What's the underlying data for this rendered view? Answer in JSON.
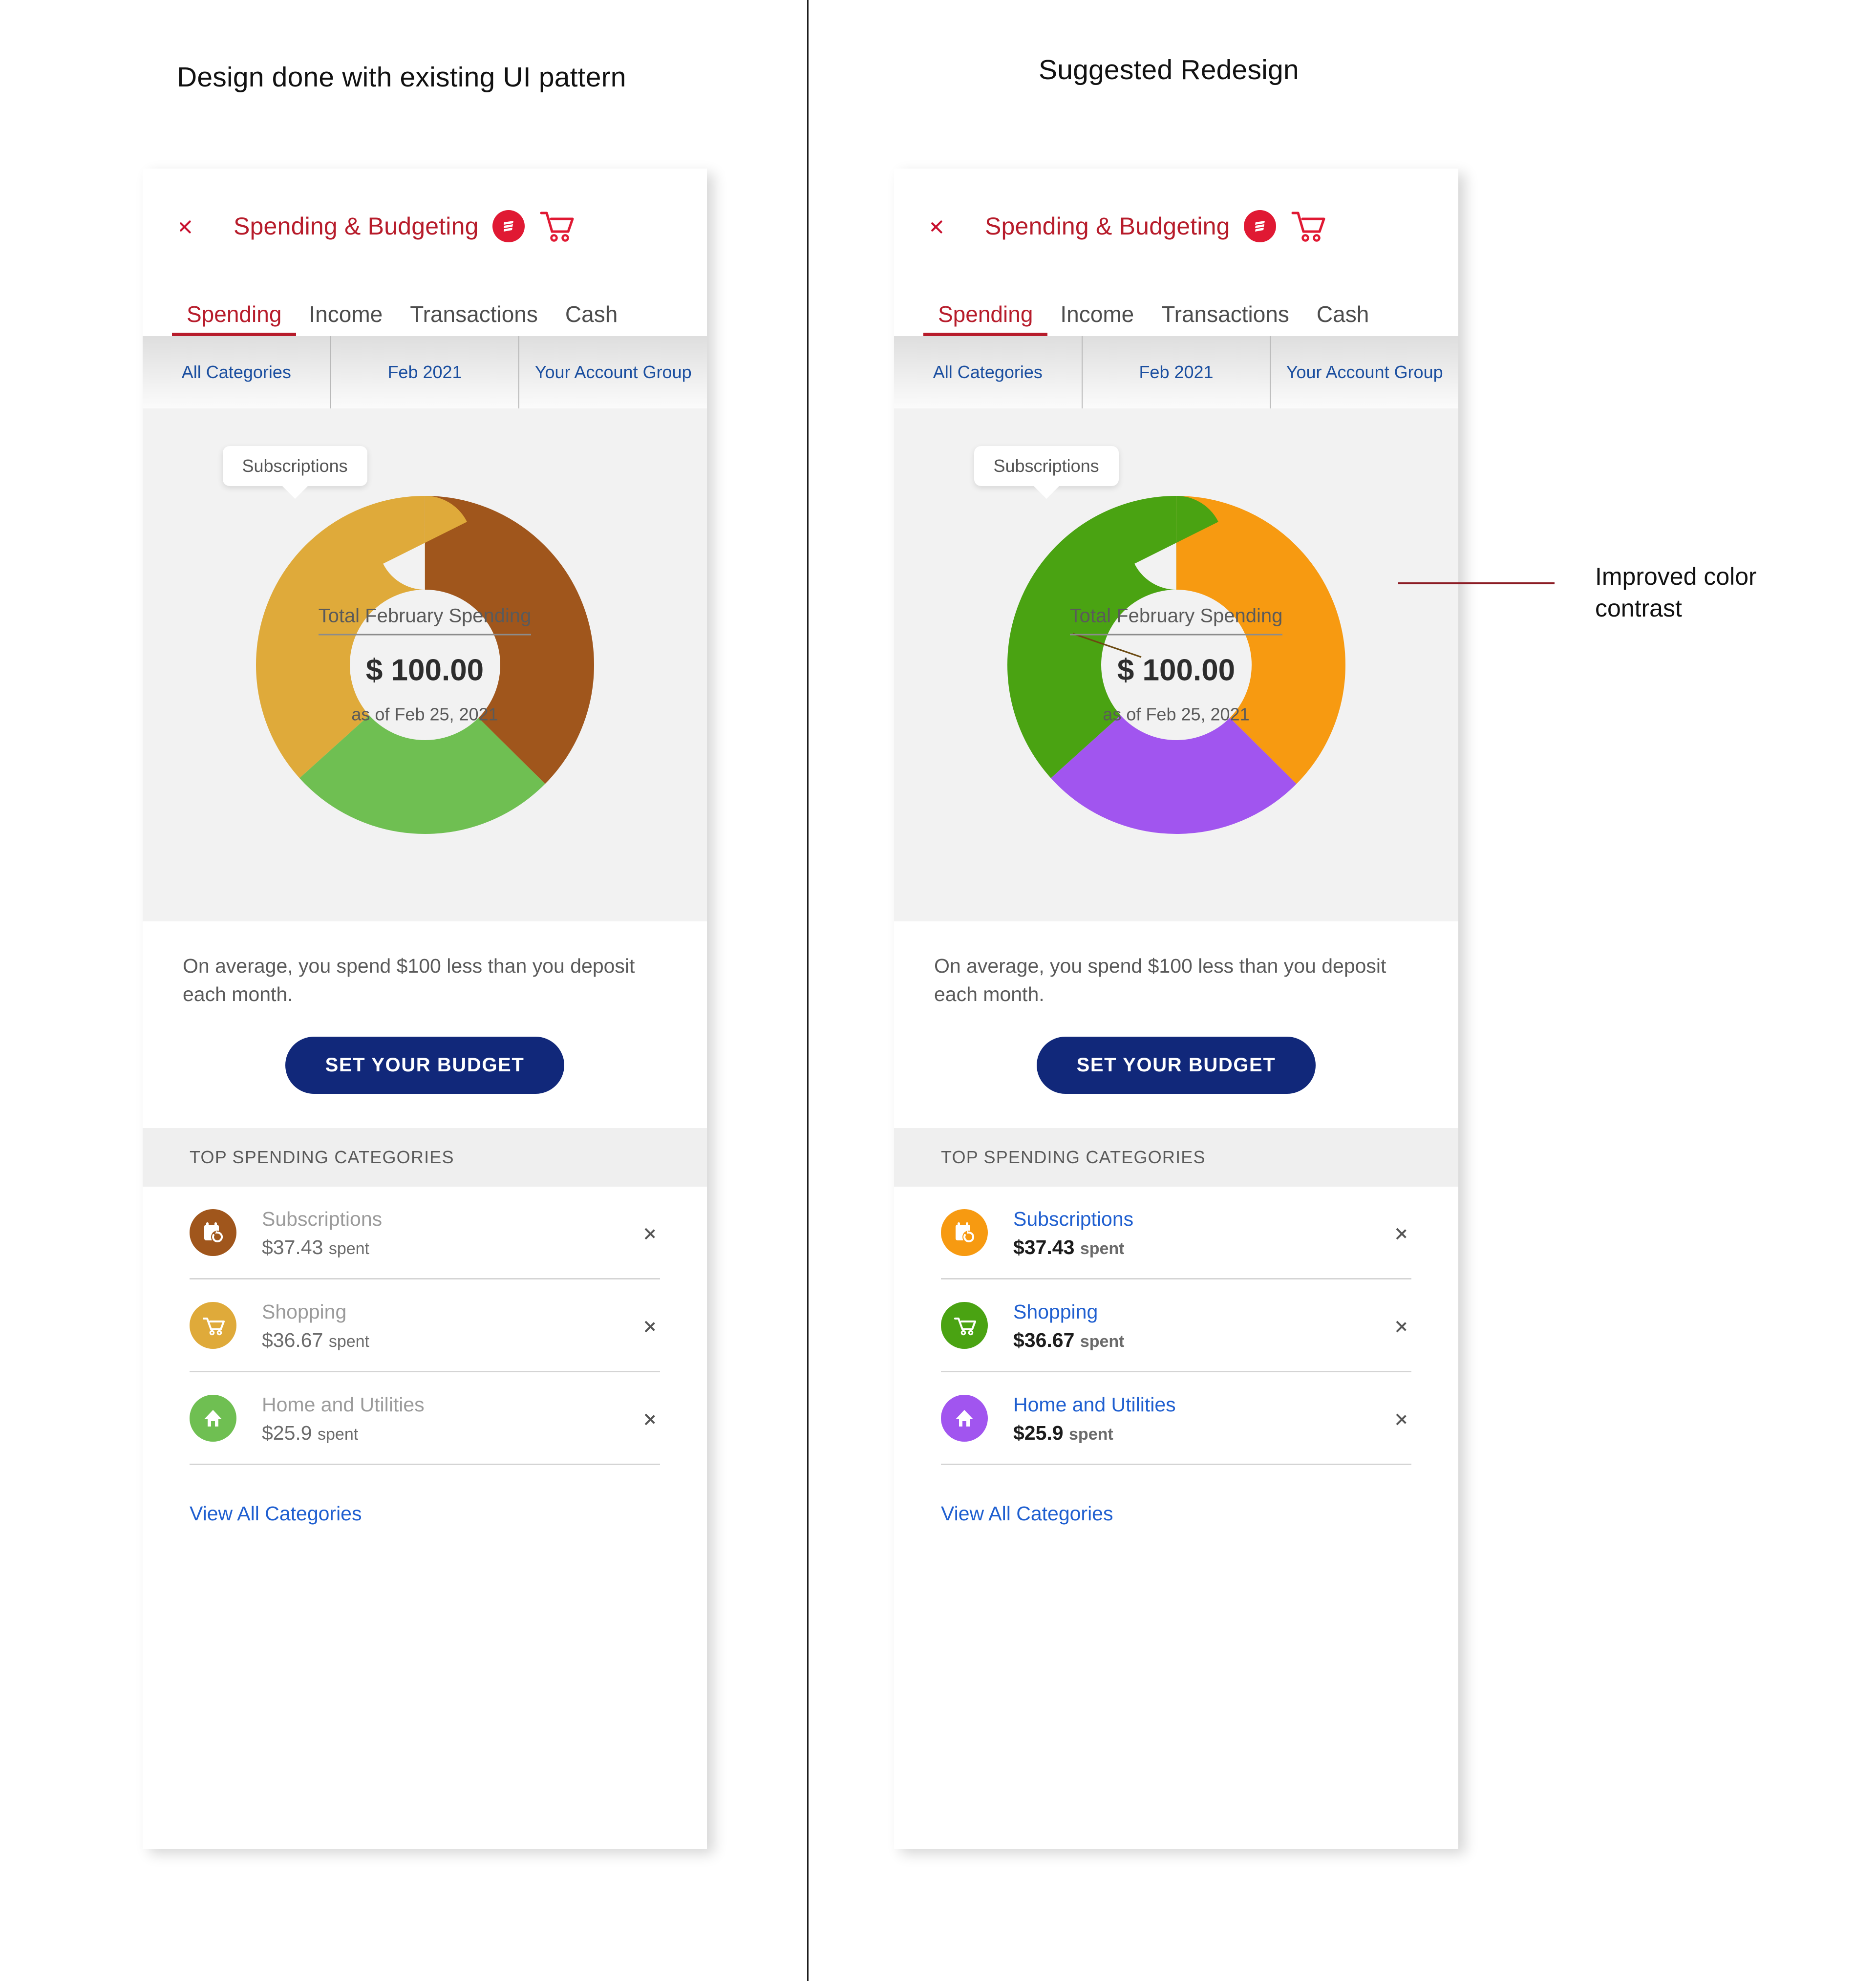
{
  "panels": {
    "left_caption": "Design done with existing UI pattern",
    "right_caption": "Suggested Redesign"
  },
  "annotation": {
    "text": "Improved color contrast",
    "line_color": "#8c1c24"
  },
  "appbar": {
    "back_label": "Back",
    "title": "Spending & Budgeting",
    "brand_icon": "brand-badge-icon",
    "cart_icon": "shopping-cart-icon"
  },
  "tabs": [
    {
      "label": "Spending",
      "active": true
    },
    {
      "label": "Income",
      "active": false
    },
    {
      "label": "Transactions",
      "active": false
    },
    {
      "label": "Cash",
      "active": false
    }
  ],
  "filters": [
    {
      "label": "All Categories"
    },
    {
      "label": "Feb 2021"
    },
    {
      "label": "Your Account Group"
    }
  ],
  "chart_center": {
    "label": "Total February Spending",
    "amount": "$ 100.00",
    "as_of": "as of  Feb 25, 2021"
  },
  "tooltip": {
    "label": "Subscriptions"
  },
  "summary": {
    "text": "On average, you spend $100 less than you deposit each month.",
    "cta_label": "SET YOUR BUDGET",
    "cta_color": "#11287a"
  },
  "categories_section": {
    "header": "TOP SPENDING CATEGORIES",
    "view_all": "View All Categories"
  },
  "categories_old": [
    {
      "name": "Subscriptions",
      "amount": "$37.43",
      "suffix": "spent",
      "icon": "subscriptions-icon",
      "color": "#a0561c"
    },
    {
      "name": "Shopping",
      "amount": "$36.67",
      "suffix": "spent",
      "icon": "shopping-cart-icon",
      "color": "#dfaa3a"
    },
    {
      "name": "Home and Utilities",
      "amount": "$25.9",
      "suffix": "spent",
      "icon": "home-icon",
      "color": "#6fbf52"
    }
  ],
  "categories_new": [
    {
      "name": "Subscriptions",
      "amount": "$37.43",
      "suffix": "spent",
      "icon": "subscriptions-icon",
      "color": "#f79a11"
    },
    {
      "name": "Shopping",
      "amount": "$36.67",
      "suffix": "spent",
      "icon": "shopping-cart-icon",
      "color": "#4aa312"
    },
    {
      "name": "Home and Utilities",
      "amount": "$25.9",
      "suffix": "spent",
      "icon": "home-icon",
      "color": "#a155ef"
    }
  ],
  "chart_data": [
    {
      "type": "pie",
      "variant": "donut",
      "title": "Total February Spending",
      "panel": "existing",
      "total": 100.0,
      "currency": "USD",
      "as_of": "Feb 25, 2021",
      "categories": [
        "Subscriptions",
        "Shopping",
        "Home and Utilities"
      ],
      "values": [
        37.43,
        36.67,
        25.9
      ],
      "colors": [
        "#a0561c",
        "#dfaa3a",
        "#6fbf52"
      ],
      "units": "dollars",
      "legend": "none",
      "annotation": "Subscriptions"
    },
    {
      "type": "pie",
      "variant": "donut",
      "title": "Total February Spending",
      "panel": "redesign",
      "total": 100.0,
      "currency": "USD",
      "as_of": "Feb 25, 2021",
      "categories": [
        "Subscriptions",
        "Home and Utilities",
        "Shopping"
      ],
      "values": [
        37.43,
        25.9,
        36.67
      ],
      "colors": [
        "#f79a11",
        "#a155ef",
        "#4aa312"
      ],
      "units": "dollars",
      "legend": "none",
      "annotation": "Subscriptions"
    }
  ]
}
